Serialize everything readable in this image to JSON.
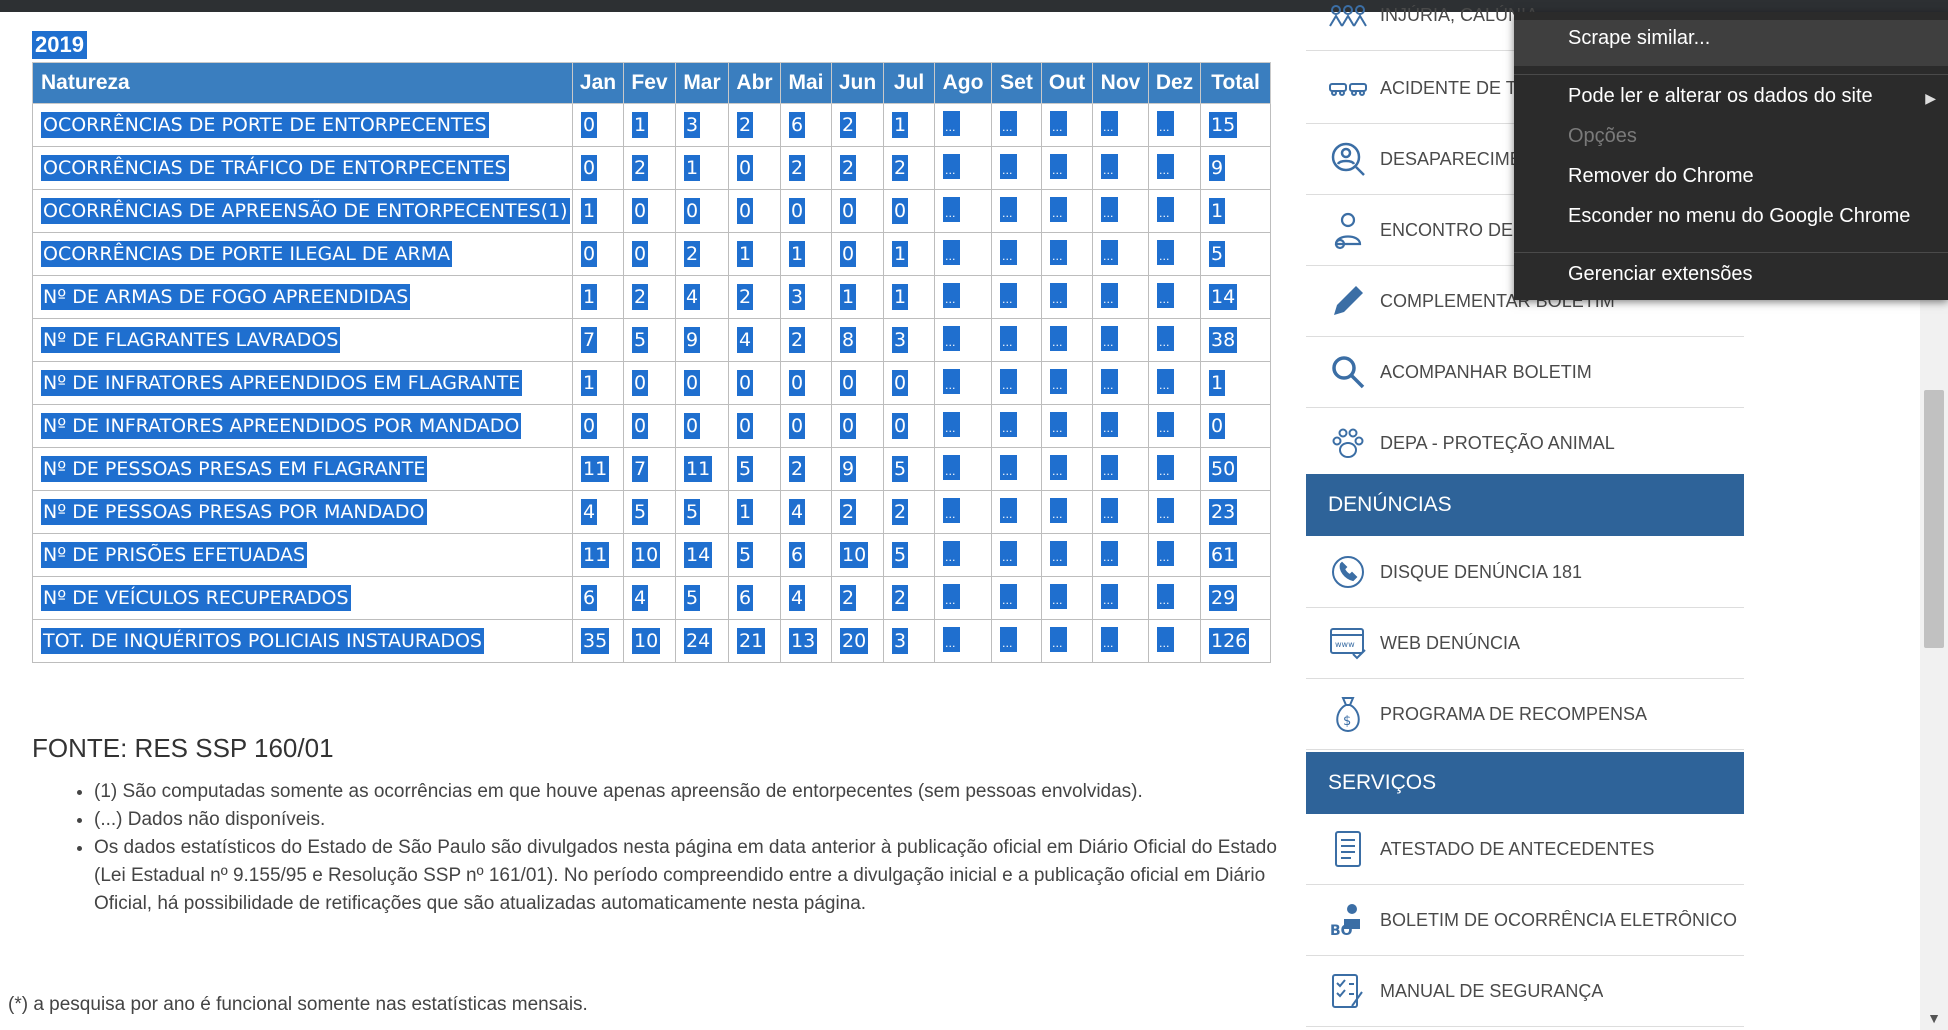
{
  "year_label": "2019",
  "table": {
    "headers": [
      "Natureza",
      "Jan",
      "Fev",
      "Mar",
      "Abr",
      "Mai",
      "Jun",
      "Jul",
      "Ago",
      "Set",
      "Out",
      "Nov",
      "Dez",
      "Total"
    ],
    "rows": [
      [
        "OCORRÊNCIAS DE PORTE DE ENTORPECENTES",
        "0",
        "1",
        "3",
        "2",
        "6",
        "2",
        "1",
        "...",
        "...",
        "...",
        "...",
        "...",
        "15"
      ],
      [
        "OCORRÊNCIAS DE TRÁFICO DE ENTORPECENTES",
        "0",
        "2",
        "1",
        "0",
        "2",
        "2",
        "2",
        "...",
        "...",
        "...",
        "...",
        "...",
        "9"
      ],
      [
        "OCORRÊNCIAS DE APREENSÃO DE ENTORPECENTES(1)",
        "1",
        "0",
        "0",
        "0",
        "0",
        "0",
        "0",
        "...",
        "...",
        "...",
        "...",
        "...",
        "1"
      ],
      [
        "OCORRÊNCIAS DE PORTE ILEGAL DE ARMA",
        "0",
        "0",
        "2",
        "1",
        "1",
        "0",
        "1",
        "...",
        "...",
        "...",
        "...",
        "...",
        "5"
      ],
      [
        "Nº DE ARMAS DE FOGO APREENDIDAS",
        "1",
        "2",
        "4",
        "2",
        "3",
        "1",
        "1",
        "...",
        "...",
        "...",
        "...",
        "...",
        "14"
      ],
      [
        "Nº DE FLAGRANTES LAVRADOS",
        "7",
        "5",
        "9",
        "4",
        "2",
        "8",
        "3",
        "...",
        "...",
        "...",
        "...",
        "...",
        "38"
      ],
      [
        "Nº DE INFRATORES APREENDIDOS EM FLAGRANTE",
        "1",
        "0",
        "0",
        "0",
        "0",
        "0",
        "0",
        "...",
        "...",
        "...",
        "...",
        "...",
        "1"
      ],
      [
        "Nº DE INFRATORES APREENDIDOS POR MANDADO",
        "0",
        "0",
        "0",
        "0",
        "0",
        "0",
        "0",
        "...",
        "...",
        "...",
        "...",
        "...",
        "0"
      ],
      [
        "Nº DE PESSOAS PRESAS EM FLAGRANTE",
        "11",
        "7",
        "11",
        "5",
        "2",
        "9",
        "5",
        "...",
        "...",
        "...",
        "...",
        "...",
        "50"
      ],
      [
        "Nº DE PESSOAS PRESAS POR MANDADO",
        "4",
        "5",
        "5",
        "1",
        "4",
        "2",
        "2",
        "...",
        "...",
        "...",
        "...",
        "...",
        "23"
      ],
      [
        "Nº DE PRISÕES EFETUADAS",
        "11",
        "10",
        "14",
        "5",
        "6",
        "10",
        "5",
        "...",
        "...",
        "...",
        "...",
        "...",
        "61"
      ],
      [
        "Nº DE VEÍCULOS RECUPERADOS",
        "6",
        "4",
        "5",
        "6",
        "4",
        "2",
        "2",
        "...",
        "...",
        "...",
        "...",
        "...",
        "29"
      ],
      [
        "TOT. DE INQUÉRITOS POLICIAIS INSTAURADOS",
        "35",
        "10",
        "24",
        "21",
        "13",
        "20",
        "3",
        "...",
        "...",
        "...",
        "...",
        "...",
        "126"
      ]
    ]
  },
  "fonte": "FONTE: RES SSP 160/01",
  "notes": [
    "(1) São computadas somente as ocorrências em que houve apenas apreensão de entorpecentes (sem pessoas envolvidas).",
    "(...) Dados não disponíveis.",
    "Os dados estatísticos do Estado de São Paulo são divulgados nesta página em data anterior à publicação oficial em Diário Oficial do Estado (Lei Estadual nº 9.155/95 e Resolução SSP nº 161/01). No período compreendido entre a divulgação inicial e a publicação oficial em Diário Oficial, há possibilidade de retificações que são atualizadas automaticamente nesta página."
  ],
  "footnote": "(*) a pesquisa por ano é funcional somente nas estatísticas mensais.",
  "sidebar": {
    "items_top": [
      {
        "label": "INJÚRIA, CALÚNIA",
        "icon": "people-icon"
      },
      {
        "label": "ACIDENTE DE TRÂ",
        "icon": "car-crash-icon"
      },
      {
        "label": "DESAPARECIMEN",
        "icon": "person-search-icon"
      },
      {
        "label": "ENCONTRO DE P",
        "icon": "person-found-icon"
      },
      {
        "label": "COMPLEMENTAR BOLETIM",
        "icon": "pencil-icon"
      },
      {
        "label": "ACOMPANHAR BOLETIM",
        "icon": "magnifier-icon"
      },
      {
        "label": "DEPA - PROTEÇÃO ANIMAL",
        "icon": "paw-icon"
      }
    ],
    "section_denuncias": "DENÚNCIAS",
    "items_denuncias": [
      {
        "label": "DISQUE DENÚNCIA 181",
        "icon": "phone-icon"
      },
      {
        "label": "WEB DENÚNCIA",
        "icon": "web-icon"
      },
      {
        "label": "PROGRAMA DE RECOMPENSA",
        "icon": "money-bag-icon"
      }
    ],
    "section_servicos": "SERVIÇOS",
    "items_servicos": [
      {
        "label": "ATESTADO DE ANTECEDENTES",
        "icon": "document-icon"
      },
      {
        "label": "BOLETIM DE OCORRÊNCIA ELETRÔNICO",
        "icon": "bo-icon"
      },
      {
        "label": "MANUAL DE SEGURANÇA",
        "icon": "checklist-icon"
      }
    ]
  },
  "context_menu": {
    "scrape": "Scrape similar...",
    "read_change": "Pode ler e alterar os dados do site",
    "options": "Opções",
    "remove": "Remover do Chrome",
    "hide": "Esconder no menu do Google Chrome",
    "manage": "Gerenciar extensões"
  }
}
